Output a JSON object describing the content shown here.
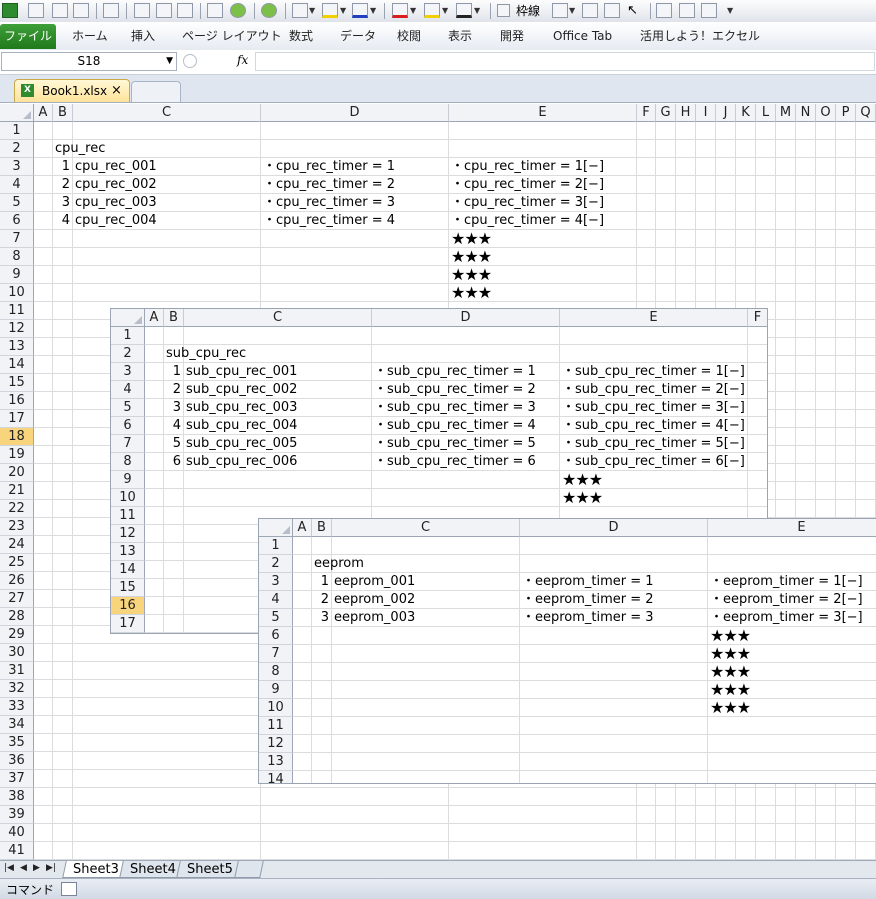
{
  "toolbar": {
    "waku_label": "枠線"
  },
  "ribbon": {
    "file_tab": "ファイル",
    "tabs": [
      "ホーム",
      "挿入",
      "ページ レイアウト",
      "数式",
      "データ",
      "校閲",
      "表示",
      "開発",
      "Office Tab",
      "活用しよう！エクセル"
    ]
  },
  "formula_bar": {
    "name_box": "S18",
    "fx_label": "fx",
    "formula": ""
  },
  "office_tab": {
    "workbook_name": "Book1.xlsx",
    "close_glyph": "×"
  },
  "main_grid": {
    "columns": [
      "A",
      "B",
      "C",
      "D",
      "E",
      "F",
      "G",
      "H",
      "I",
      "J",
      "K",
      "L",
      "M",
      "N",
      "O",
      "P",
      "Q"
    ],
    "rows": [
      "1",
      "2",
      "3",
      "4",
      "5",
      "6",
      "7",
      "8",
      "9",
      "10",
      "11",
      "12",
      "13",
      "14",
      "15",
      "16",
      "17",
      "18",
      "19",
      "20",
      "21",
      "22",
      "23",
      "24",
      "25",
      "26",
      "27",
      "28",
      "29",
      "30",
      "31",
      "32",
      "33",
      "34",
      "35",
      "36",
      "37",
      "38",
      "39",
      "40",
      "41"
    ],
    "selected_row": "18",
    "title": "cpu_rec",
    "records": [
      {
        "no": "1",
        "name": "cpu_rec_001",
        "timer": "・cpu_rec_timer = 1",
        "timer_e": "・cpu_rec_timer = 1[−]"
      },
      {
        "no": "2",
        "name": "cpu_rec_002",
        "timer": "・cpu_rec_timer = 2",
        "timer_e": "・cpu_rec_timer = 2[−]"
      },
      {
        "no": "3",
        "name": "cpu_rec_003",
        "timer": "・cpu_rec_timer = 3",
        "timer_e": "・cpu_rec_timer = 3[−]"
      },
      {
        "no": "4",
        "name": "cpu_rec_004",
        "timer": "・cpu_rec_timer = 4",
        "timer_e": "・cpu_rec_timer = 4[−]"
      }
    ],
    "stars": [
      "★★★",
      "★★★",
      "★★★",
      "★★★"
    ]
  },
  "sub_grid": {
    "columns": [
      "A",
      "B",
      "C",
      "D",
      "E",
      "F"
    ],
    "rows": [
      "1",
      "2",
      "3",
      "4",
      "5",
      "6",
      "7",
      "8",
      "9",
      "10",
      "11",
      "12",
      "13",
      "14",
      "15",
      "16",
      "17"
    ],
    "selected_row": "16",
    "title": "sub_cpu_rec",
    "records": [
      {
        "no": "1",
        "name": "sub_cpu_rec_001",
        "timer": "・sub_cpu_rec_timer = 1",
        "timer_e": "・sub_cpu_rec_timer = 1[−]"
      },
      {
        "no": "2",
        "name": "sub_cpu_rec_002",
        "timer": "・sub_cpu_rec_timer = 2",
        "timer_e": "・sub_cpu_rec_timer = 2[−]"
      },
      {
        "no": "3",
        "name": "sub_cpu_rec_003",
        "timer": "・sub_cpu_rec_timer = 3",
        "timer_e": "・sub_cpu_rec_timer = 3[−]"
      },
      {
        "no": "4",
        "name": "sub_cpu_rec_004",
        "timer": "・sub_cpu_rec_timer = 4",
        "timer_e": "・sub_cpu_rec_timer = 4[−]"
      },
      {
        "no": "5",
        "name": "sub_cpu_rec_005",
        "timer": "・sub_cpu_rec_timer = 5",
        "timer_e": "・sub_cpu_rec_timer = 5[−]"
      },
      {
        "no": "6",
        "name": "sub_cpu_rec_006",
        "timer": "・sub_cpu_rec_timer = 6",
        "timer_e": "・sub_cpu_rec_timer = 6[−]"
      }
    ],
    "stars": [
      "★★★",
      "★★★"
    ]
  },
  "eeprom_grid": {
    "columns": [
      "A",
      "B",
      "C",
      "D",
      "E"
    ],
    "rows": [
      "1",
      "2",
      "3",
      "4",
      "5",
      "6",
      "7",
      "8",
      "9",
      "10",
      "11",
      "12",
      "13",
      "14"
    ],
    "title": "eeprom",
    "records": [
      {
        "no": "1",
        "name": "eeprom_001",
        "timer": "・eeprom_timer = 1",
        "timer_e": "・eeprom_timer = 1[−]"
      },
      {
        "no": "2",
        "name": "eeprom_002",
        "timer": "・eeprom_timer = 2",
        "timer_e": "・eeprom_timer = 2[−]"
      },
      {
        "no": "3",
        "name": "eeprom_003",
        "timer": "・eeprom_timer = 3",
        "timer_e": "・eeprom_timer = 3[−]"
      }
    ],
    "stars": [
      "★★★",
      "★★★",
      "★★★",
      "★★★",
      "★★★"
    ]
  },
  "sheets": {
    "tabs": [
      "Sheet3",
      "Sheet4",
      "Sheet5"
    ],
    "active": "Sheet3"
  },
  "status": {
    "mode": "コマンド"
  }
}
